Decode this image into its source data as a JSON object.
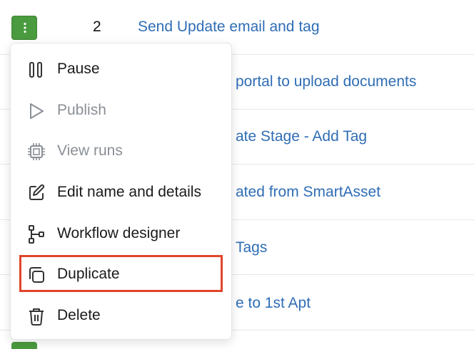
{
  "rows": [
    {
      "count": "2",
      "title": "Send Update email and tag"
    },
    {
      "count": "",
      "title": "portal to upload documents"
    },
    {
      "count": "",
      "title": "ate Stage - Add Tag"
    },
    {
      "count": "",
      "title": "ated from SmartAsset"
    },
    {
      "count": "",
      "title": "Tags"
    },
    {
      "count": "",
      "title": "e to 1st Apt"
    }
  ],
  "menu": {
    "items": [
      {
        "label": "Pause",
        "icon": "pause-icon",
        "disabled": false
      },
      {
        "label": "Publish",
        "icon": "play-icon",
        "disabled": true
      },
      {
        "label": "View runs",
        "icon": "chip-icon",
        "disabled": true
      },
      {
        "label": "Edit name and details",
        "icon": "edit-icon",
        "disabled": false
      },
      {
        "label": "Workflow designer",
        "icon": "workflow-icon",
        "disabled": false
      },
      {
        "label": "Duplicate",
        "icon": "duplicate-icon",
        "disabled": false
      },
      {
        "label": "Delete",
        "icon": "trash-icon",
        "disabled": false
      }
    ],
    "highlighted": "Duplicate"
  },
  "colors": {
    "link": "#2f6db5",
    "kebab_button": "#4a9a3f",
    "highlight_border": "#e0452a",
    "disabled_text": "#8a8f96"
  }
}
